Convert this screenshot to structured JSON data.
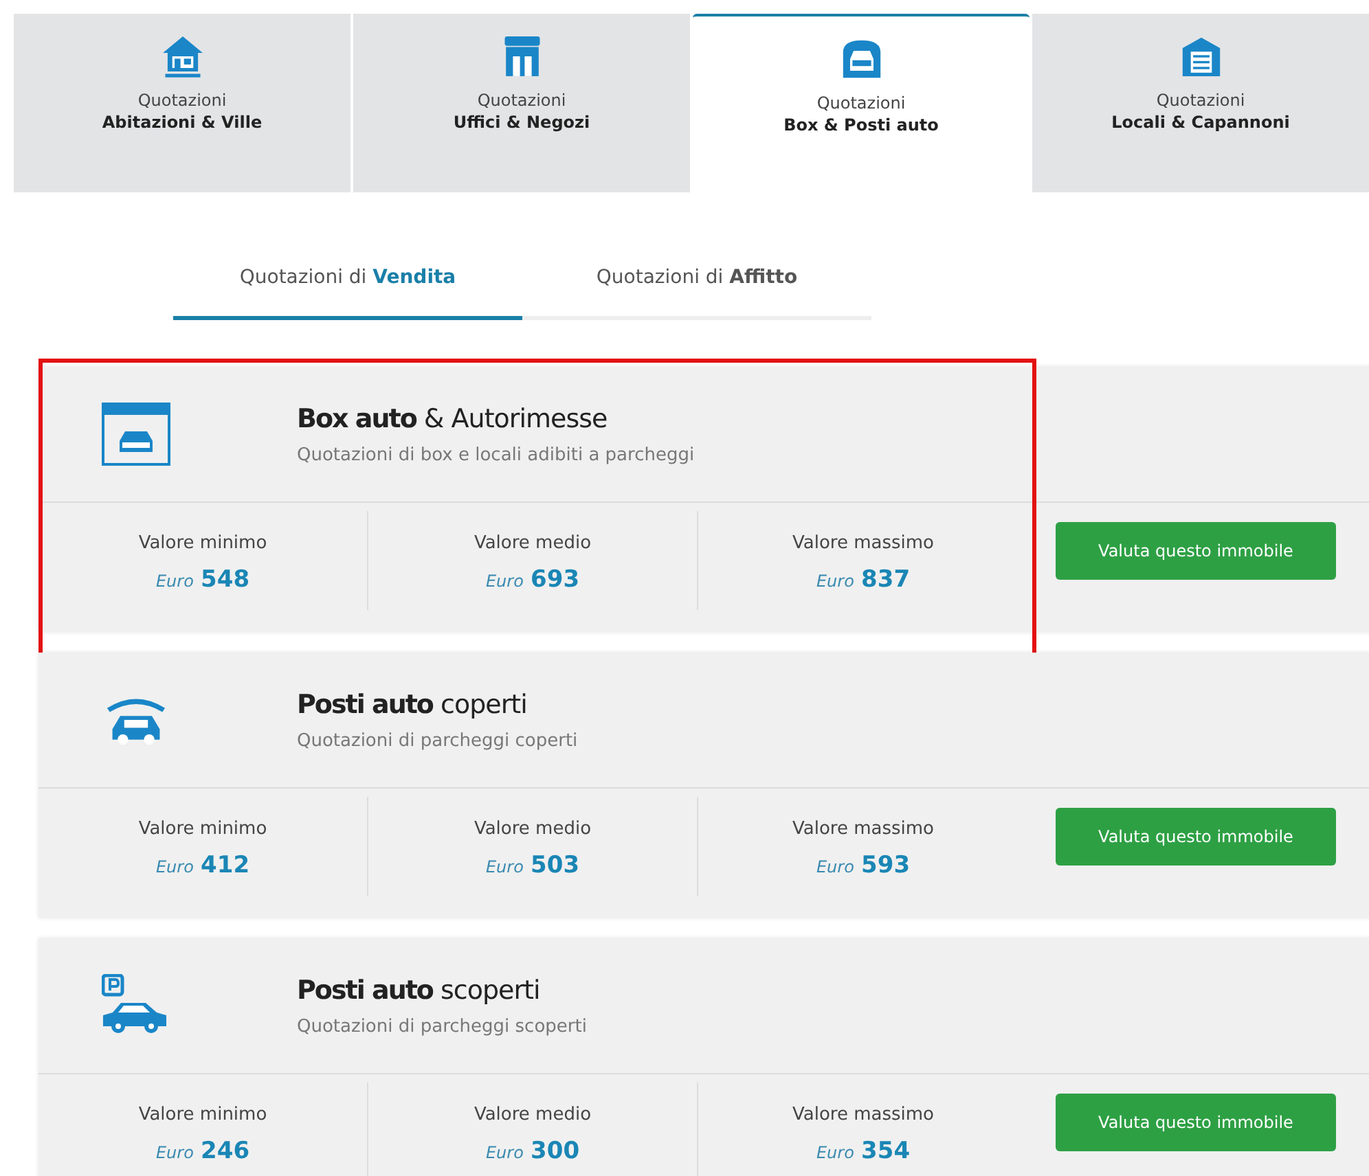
{
  "category_tabs": [
    {
      "kind": "house",
      "line1": "Quotazioni",
      "line2": "Abitazioni & Ville",
      "selected": false
    },
    {
      "kind": "shop",
      "line1": "Quotazioni",
      "line2": "Uffici & Negozi",
      "selected": false
    },
    {
      "kind": "garage",
      "line1": "Quotazioni",
      "line2": "Box & Posti auto",
      "selected": true
    },
    {
      "kind": "warehouse",
      "line1": "Quotazioni",
      "line2": "Locali & Capannoni",
      "selected": false
    }
  ],
  "mode_tabs": [
    {
      "label": "Quotazioni di **Vendita**",
      "selected": true
    },
    {
      "label": "Quotazioni di **Affitto**",
      "selected": false
    }
  ],
  "cards": [
    {
      "kind": "garage",
      "title": "**Box auto** & Autorimesse",
      "subtitle": "Quotazioni di box e locali adibiti a parcheggi",
      "highlighted": true,
      "values": [
        {
          "label": "Valore minimo",
          "currency": "Euro",
          "amount": "548"
        },
        {
          "label": "Valore medio",
          "currency": "Euro",
          "amount": "693"
        },
        {
          "label": "Valore massimo",
          "currency": "Euro",
          "amount": "837"
        }
      ],
      "button": "Valuta questo immobile"
    },
    {
      "kind": "covered",
      "title": "**Posti auto** coperti",
      "subtitle": "Quotazioni di parcheggi coperti",
      "highlighted": false,
      "values": [
        {
          "label": "Valore minimo",
          "currency": "Euro",
          "amount": "412"
        },
        {
          "label": "Valore medio",
          "currency": "Euro",
          "amount": "503"
        },
        {
          "label": "Valore massimo",
          "currency": "Euro",
          "amount": "593"
        }
      ],
      "button": "Valuta questo immobile"
    },
    {
      "kind": "parking",
      "title": "**Posti auto** scoperti",
      "subtitle": "Quotazioni di parcheggi scoperti",
      "highlighted": false,
      "values": [
        {
          "label": "Valore minimo",
          "currency": "Euro",
          "amount": "246"
        },
        {
          "label": "Valore medio",
          "currency": "Euro",
          "amount": "300"
        },
        {
          "label": "Valore massimo",
          "currency": "Euro",
          "amount": "354"
        }
      ],
      "button": "Valuta questo immobile"
    }
  ]
}
